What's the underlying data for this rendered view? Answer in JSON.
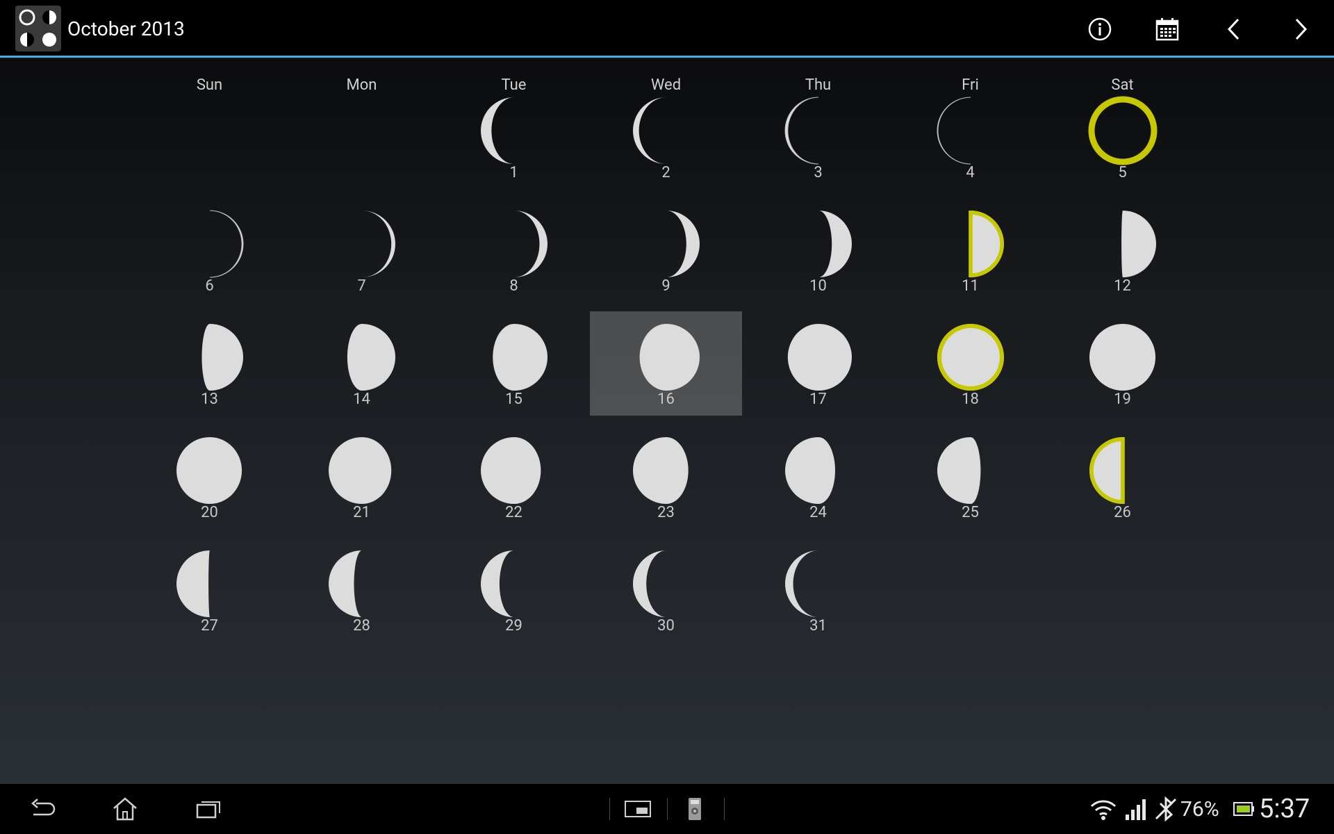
{
  "header": {
    "title": "October 2013",
    "app_icon": "moon-phases-app-icon",
    "actions": [
      {
        "name": "info-button",
        "icon": "info-icon"
      },
      {
        "name": "calendar-button",
        "icon": "calendar-icon"
      },
      {
        "name": "previous-month-button",
        "icon": "chevron-left-icon"
      },
      {
        "name": "next-month-button",
        "icon": "chevron-right-icon"
      }
    ],
    "accent_color": "#33b5e5"
  },
  "calendar": {
    "weekdays": [
      "Sun",
      "Mon",
      "Tue",
      "Wed",
      "Thu",
      "Fri",
      "Sat"
    ],
    "first_weekday_index": 2,
    "selected_day": 16,
    "highlight_color": "#c8c800",
    "days": [
      {
        "day": "1",
        "illumination": 0.16,
        "waxing": false,
        "highlight": false
      },
      {
        "day": "2",
        "illumination": 0.09,
        "waxing": false,
        "highlight": false
      },
      {
        "day": "3",
        "illumination": 0.04,
        "waxing": false,
        "highlight": false
      },
      {
        "day": "4",
        "illumination": 0.01,
        "waxing": false,
        "highlight": false
      },
      {
        "day": "5",
        "illumination": 0.0,
        "waxing": true,
        "highlight": true
      },
      {
        "day": "6",
        "illumination": 0.02,
        "waxing": true,
        "highlight": false
      },
      {
        "day": "7",
        "illumination": 0.06,
        "waxing": true,
        "highlight": false
      },
      {
        "day": "8",
        "illumination": 0.12,
        "waxing": true,
        "highlight": false
      },
      {
        "day": "9",
        "illumination": 0.2,
        "waxing": true,
        "highlight": false
      },
      {
        "day": "10",
        "illumination": 0.3,
        "waxing": true,
        "highlight": false
      },
      {
        "day": "11",
        "illumination": 0.5,
        "waxing": true,
        "highlight": true
      },
      {
        "day": "12",
        "illumination": 0.52,
        "waxing": true,
        "highlight": false
      },
      {
        "day": "13",
        "illumination": 0.62,
        "waxing": true,
        "highlight": false
      },
      {
        "day": "14",
        "illumination": 0.72,
        "waxing": true,
        "highlight": false
      },
      {
        "day": "15",
        "illumination": 0.82,
        "waxing": true,
        "highlight": false
      },
      {
        "day": "16",
        "illumination": 0.9,
        "waxing": true,
        "highlight": false
      },
      {
        "day": "17",
        "illumination": 0.96,
        "waxing": true,
        "highlight": false
      },
      {
        "day": "18",
        "illumination": 1.0,
        "waxing": true,
        "highlight": true
      },
      {
        "day": "19",
        "illumination": 0.99,
        "waxing": false,
        "highlight": false
      },
      {
        "day": "20",
        "illumination": 0.98,
        "waxing": false,
        "highlight": false
      },
      {
        "day": "21",
        "illumination": 0.94,
        "waxing": false,
        "highlight": false
      },
      {
        "day": "22",
        "illumination": 0.9,
        "waxing": false,
        "highlight": false
      },
      {
        "day": "23",
        "illumination": 0.83,
        "waxing": false,
        "highlight": false
      },
      {
        "day": "24",
        "illumination": 0.75,
        "waxing": false,
        "highlight": false
      },
      {
        "day": "25",
        "illumination": 0.65,
        "waxing": false,
        "highlight": false
      },
      {
        "day": "26",
        "illumination": 0.5,
        "waxing": false,
        "highlight": true
      },
      {
        "day": "27",
        "illumination": 0.48,
        "waxing": false,
        "highlight": false
      },
      {
        "day": "28",
        "illumination": 0.38,
        "waxing": false,
        "highlight": false
      },
      {
        "day": "29",
        "illumination": 0.28,
        "waxing": false,
        "highlight": false
      },
      {
        "day": "30",
        "illumination": 0.2,
        "waxing": false,
        "highlight": false
      },
      {
        "day": "31",
        "illumination": 0.12,
        "waxing": false,
        "highlight": false
      }
    ]
  },
  "navbar": {
    "buttons": [
      "back-icon",
      "home-icon",
      "recent-apps-icon"
    ],
    "small_apps": [
      "small-app-window-icon",
      "remote-control-icon"
    ]
  },
  "status": {
    "icons": [
      "wifi-icon",
      "signal-icon",
      "bluetooth-off-icon",
      "battery-icon"
    ],
    "battery_percent": "76%",
    "time": "5:37"
  }
}
